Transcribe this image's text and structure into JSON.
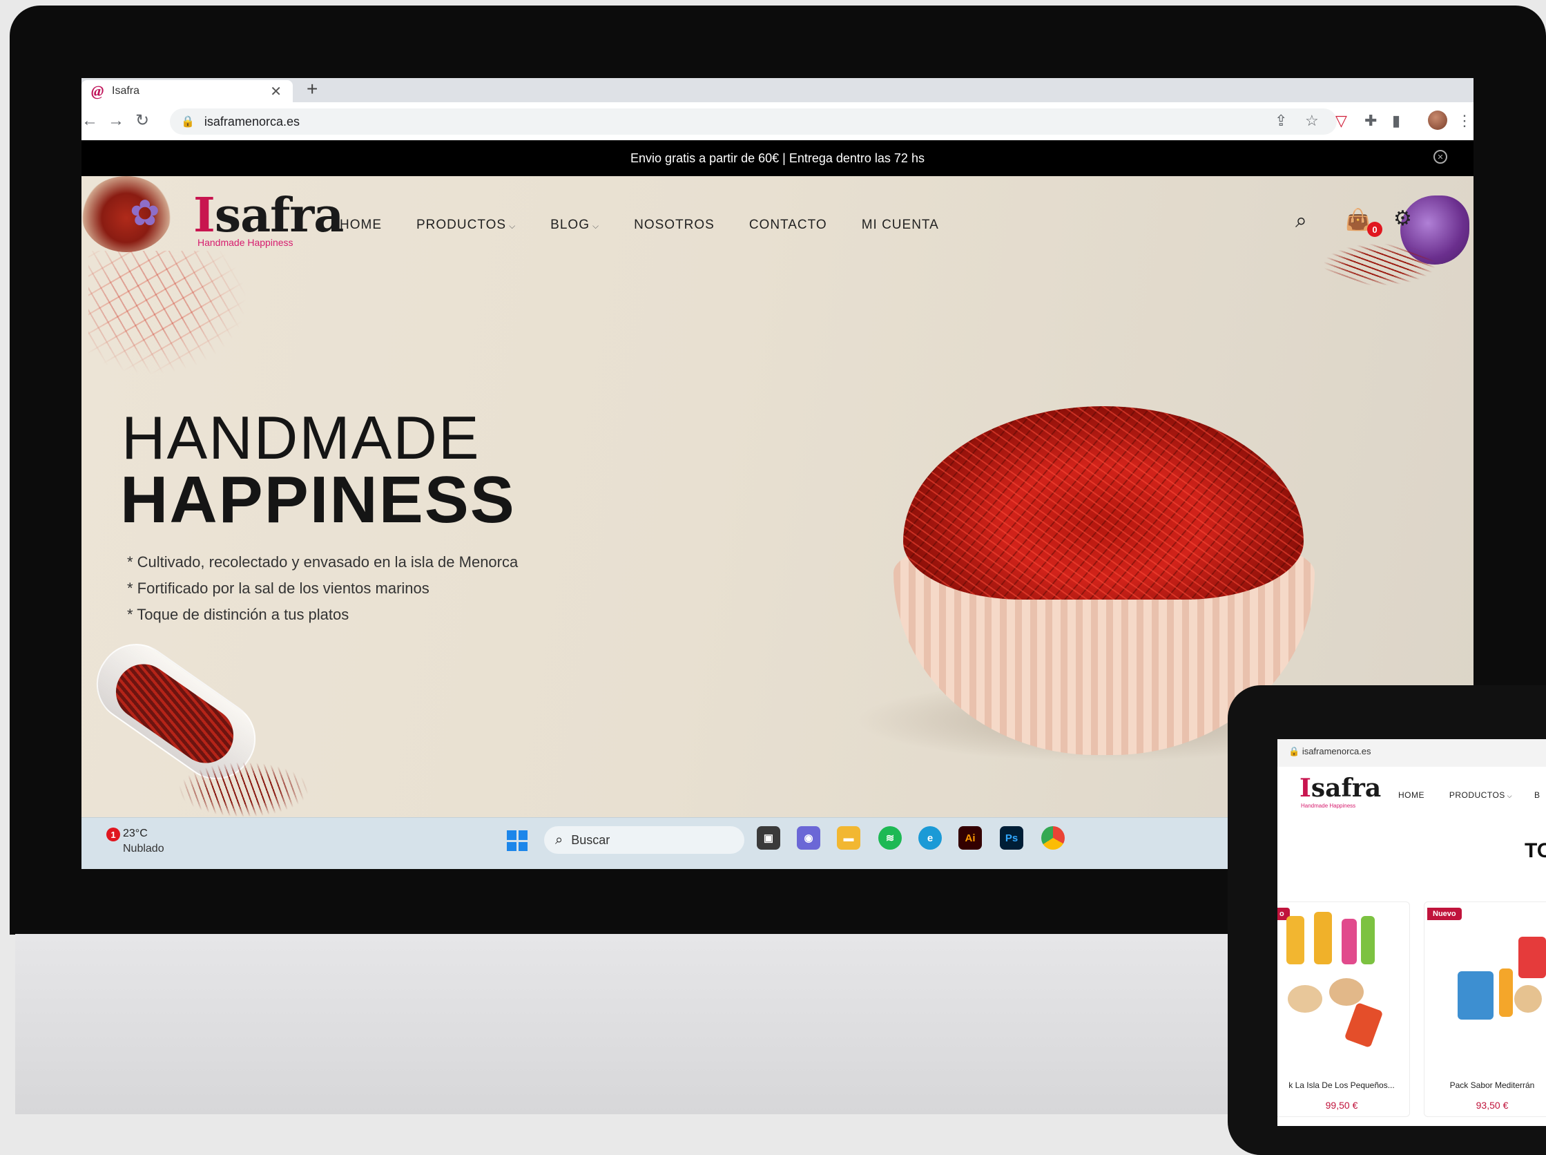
{
  "browser": {
    "tab_title": "Isafra",
    "url": "isaframenorca.es"
  },
  "site": {
    "announcement": "Envio gratis a partir de 60€ | Entrega dentro las 72 hs",
    "logo_initial": "I",
    "logo_rest": "safra",
    "logo_tagline": "Handmade Happiness",
    "menu": [
      {
        "label": "HOME"
      },
      {
        "label": "PRODUCTOS",
        "has_dropdown": true
      },
      {
        "label": "BLOG",
        "has_dropdown": true
      },
      {
        "label": "NOSOTROS"
      },
      {
        "label": "CONTACTO"
      },
      {
        "label": "MI CUENTA"
      }
    ],
    "cart_count": "0",
    "hero": {
      "line1": "HANDMADE",
      "line2": "HAPPINESS",
      "bullets": [
        "* Cultivado, recolectado y envasado en la isla de Menorca",
        "* Fortificado por la sal de los vientos marinos",
        "* Toque de distinción a tus platos"
      ]
    }
  },
  "taskbar": {
    "notification_count": "1",
    "temperature": "23°C",
    "weather": "Nublado",
    "search_label": "Buscar",
    "apps": [
      "task-view",
      "chat",
      "file-explorer",
      "spotify",
      "edge",
      "illustrator",
      "photoshop",
      "chrome"
    ]
  },
  "tablet": {
    "url": "isaframenorca.es",
    "logo_initial": "I",
    "logo_rest": "safra",
    "logo_tagline": "Handmade Happiness",
    "nav": [
      "HOME",
      "PRODUCTOS",
      "B"
    ],
    "heading_partial": "TO",
    "products": [
      {
        "name": "k La Isla De Los Pequeños...",
        "price": "99,50 €",
        "badge": "o"
      },
      {
        "name": "Pack Sabor Mediterrán",
        "price": "93,50 €",
        "badge": "Nuevo"
      }
    ]
  },
  "colors": {
    "brand_magenta": "#c8154f",
    "announcement_bg": "#000000",
    "hero_bg": "#e8e0d1"
  }
}
